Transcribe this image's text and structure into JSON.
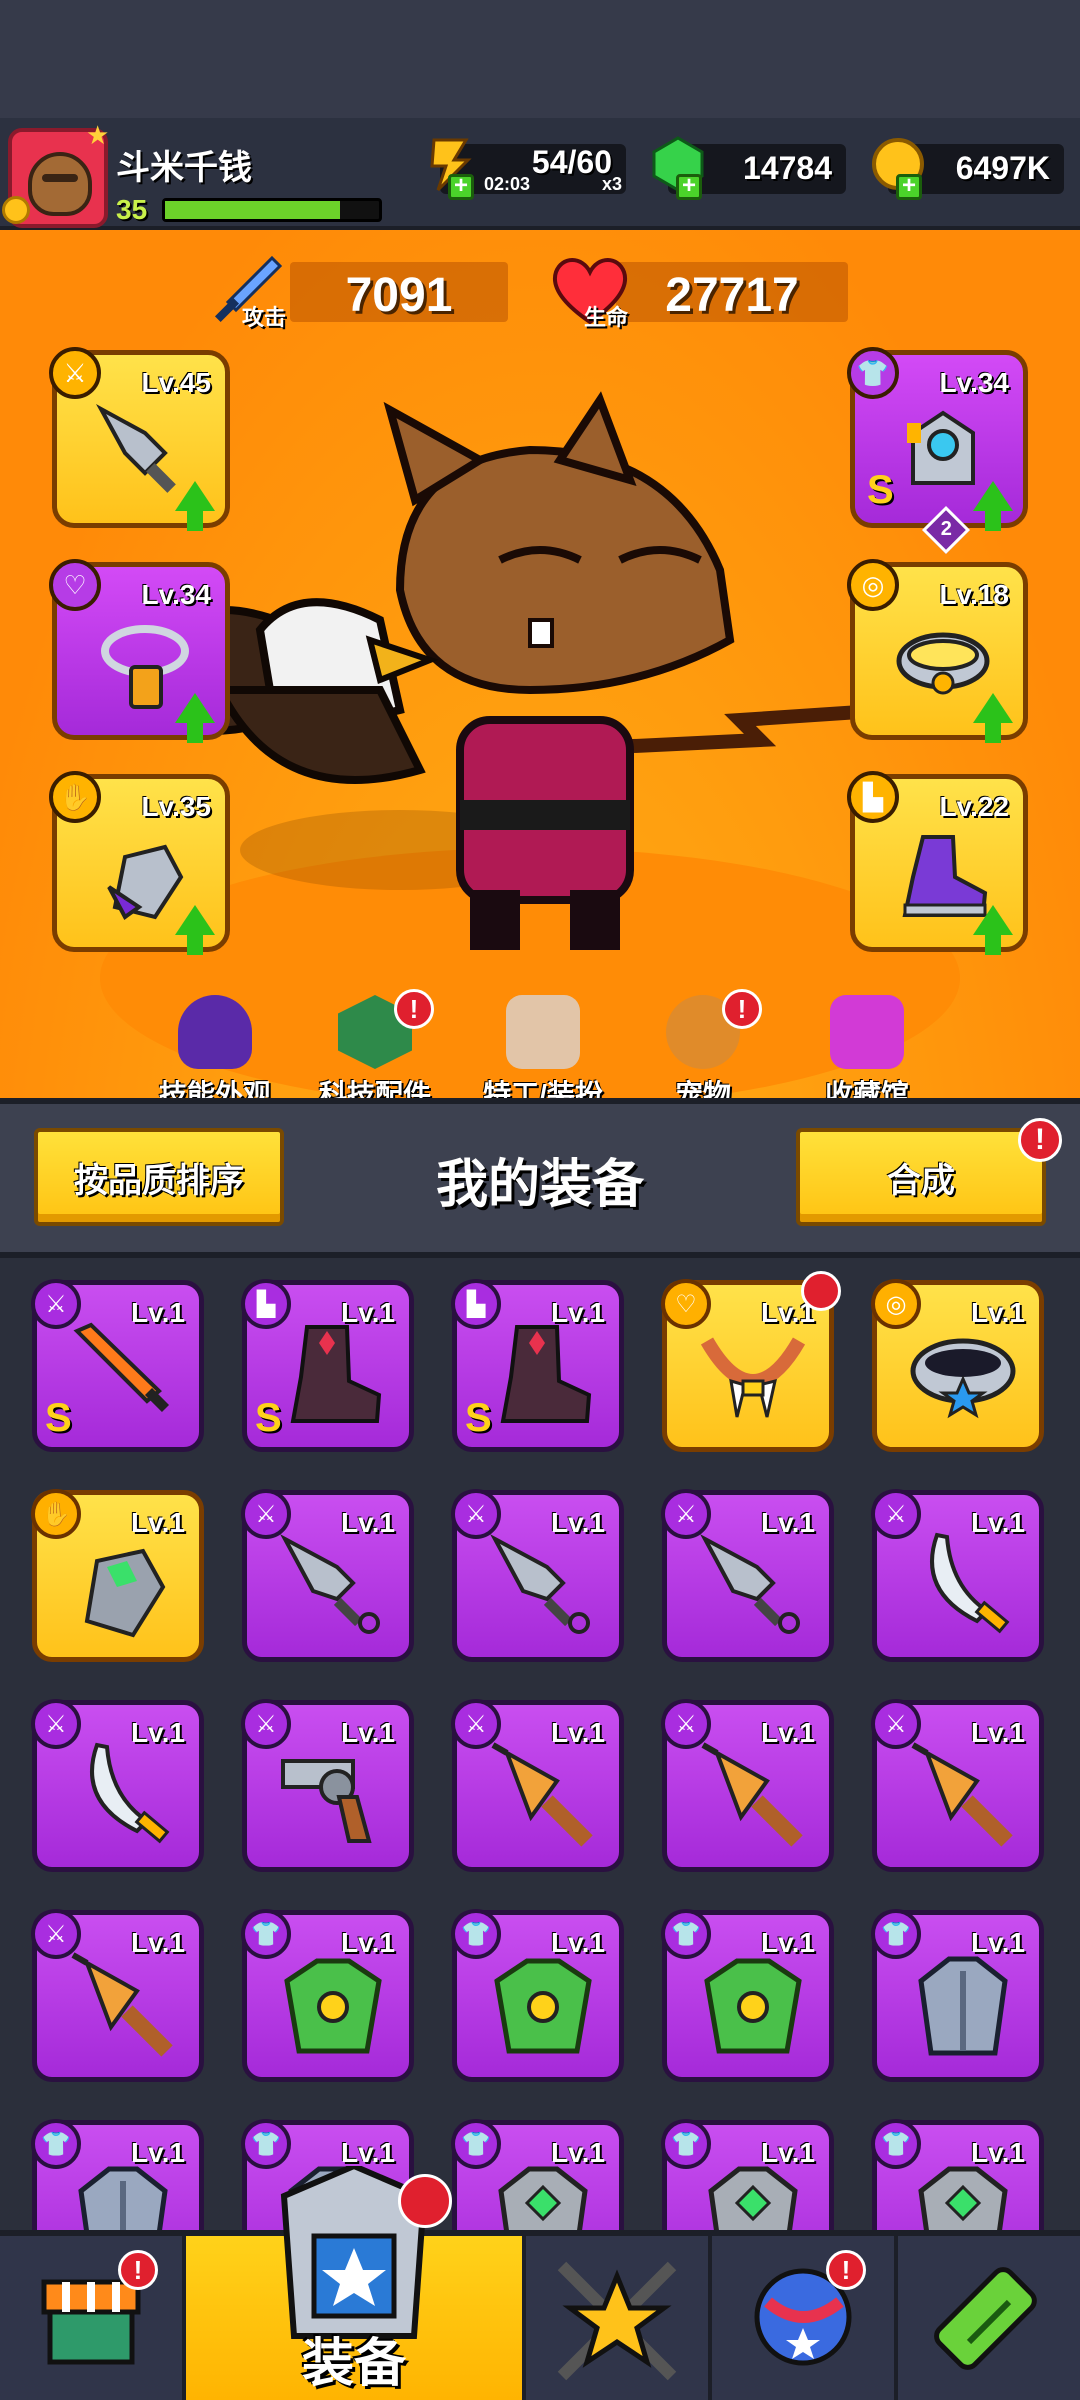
{
  "player": {
    "name": "斗米千钱",
    "level": "35"
  },
  "resources": {
    "energy": {
      "value": "54/60",
      "timer": "02:03",
      "multiplier": "x3"
    },
    "gems": "14784",
    "coins": "6497K"
  },
  "stats": {
    "attack_value": "7091",
    "attack_label": "攻击",
    "hp_value": "27717",
    "hp_label": "生命"
  },
  "equipped": {
    "left": [
      {
        "slot": "weapon",
        "level": "Lv.45",
        "rarity": "gold"
      },
      {
        "slot": "necklace",
        "level": "Lv.34",
        "rarity": "purple"
      },
      {
        "slot": "gloves",
        "level": "Lv.35",
        "rarity": "gold"
      }
    ],
    "right": [
      {
        "slot": "armor",
        "level": "Lv.34",
        "rarity": "purple",
        "grade": "S",
        "stars": "2"
      },
      {
        "slot": "belt",
        "level": "Lv.18",
        "rarity": "gold"
      },
      {
        "slot": "boots",
        "level": "Lv.22",
        "rarity": "gold"
      }
    ]
  },
  "menu": [
    {
      "label": "技能外观",
      "badge": false
    },
    {
      "label": "科技配件",
      "badge": true
    },
    {
      "label": "特工/装扮",
      "badge": false
    },
    {
      "label": "宠物",
      "badge": true
    },
    {
      "label": "收藏馆",
      "badge": false
    }
  ],
  "subbar": {
    "sort_label": "按品质排序",
    "title": "我的装备",
    "merge_label": "合成",
    "merge_badge": "!"
  },
  "inventory": [
    {
      "level": "Lv.1",
      "rarity": "purple",
      "item": "flame-sword",
      "grade": "S"
    },
    {
      "level": "Lv.1",
      "rarity": "purple",
      "item": "dark-boots",
      "grade": "S"
    },
    {
      "level": "Lv.1",
      "rarity": "purple",
      "item": "dark-boots",
      "grade": "S"
    },
    {
      "level": "Lv.1",
      "rarity": "gold",
      "item": "fang-necklace",
      "grade": ""
    },
    {
      "level": "Lv.1",
      "rarity": "gold",
      "item": "star-belt",
      "grade": ""
    },
    {
      "level": "Lv.1",
      "rarity": "gold",
      "item": "mech-glove",
      "grade": ""
    },
    {
      "level": "Lv.1",
      "rarity": "purple",
      "item": "kunai",
      "grade": ""
    },
    {
      "level": "Lv.1",
      "rarity": "purple",
      "item": "kunai",
      "grade": ""
    },
    {
      "level": "Lv.1",
      "rarity": "purple",
      "item": "kunai",
      "grade": ""
    },
    {
      "level": "Lv.1",
      "rarity": "purple",
      "item": "machete",
      "grade": ""
    },
    {
      "level": "Lv.1",
      "rarity": "purple",
      "item": "machete",
      "grade": ""
    },
    {
      "level": "Lv.1",
      "rarity": "purple",
      "item": "revolver",
      "grade": ""
    },
    {
      "level": "Lv.1",
      "rarity": "purple",
      "item": "drill",
      "grade": ""
    },
    {
      "level": "Lv.1",
      "rarity": "purple",
      "item": "drill",
      "grade": ""
    },
    {
      "level": "Lv.1",
      "rarity": "purple",
      "item": "drill",
      "grade": ""
    },
    {
      "level": "Lv.1",
      "rarity": "purple",
      "item": "drill",
      "grade": ""
    },
    {
      "level": "Lv.1",
      "rarity": "purple",
      "item": "green-armor",
      "grade": ""
    },
    {
      "level": "Lv.1",
      "rarity": "purple",
      "item": "green-armor",
      "grade": ""
    },
    {
      "level": "Lv.1",
      "rarity": "purple",
      "item": "green-armor",
      "grade": ""
    },
    {
      "level": "Lv.1",
      "rarity": "purple",
      "item": "steel-armor",
      "grade": ""
    },
    {
      "level": "Lv.1",
      "rarity": "purple",
      "item": "steel-armor",
      "grade": ""
    },
    {
      "level": "Lv.1",
      "rarity": "purple",
      "item": "steel-armor",
      "grade": ""
    },
    {
      "level": "Lv.1",
      "rarity": "purple",
      "item": "gem-armor",
      "grade": ""
    },
    {
      "level": "Lv.1",
      "rarity": "purple",
      "item": "gem-armor",
      "grade": ""
    },
    {
      "level": "Lv.1",
      "rarity": "purple",
      "item": "gem-armor",
      "grade": ""
    }
  ],
  "nav": [
    {
      "name": "shop",
      "label": "",
      "badge": true
    },
    {
      "name": "equipment",
      "label": "装备",
      "badge": true,
      "active": true
    },
    {
      "name": "battle",
      "label": "",
      "badge": false
    },
    {
      "name": "planet",
      "label": "",
      "badge": true
    },
    {
      "name": "evolve",
      "label": "",
      "badge": false
    }
  ],
  "colors": {
    "gold": "#ffc21a",
    "purple": "#a52ad9",
    "hero_bg": "#ff9c0e",
    "badge_red": "#e0202e"
  }
}
